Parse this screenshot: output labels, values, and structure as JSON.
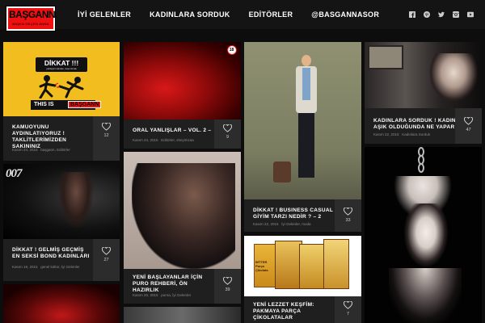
{
  "brand": {
    "name": "BAŞGANN",
    "tagline": "BAŞKA GEÇEN ANNA"
  },
  "nav": [
    "İYİ GELENLER",
    "KADINLARA SORDUK",
    "EDİTÖRLER",
    "@BASGANNASOR"
  ],
  "social": [
    "facebook-icon",
    "pinterest-icon",
    "twitter-icon",
    "instagram-icon",
    "youtube-icon"
  ],
  "colors": {
    "brand_red": "#e11111",
    "bg": "#0d0d0d",
    "caption": "#1f1f1f",
    "likes": "#2c2c2c"
  },
  "cards": {
    "c1": {
      "img": {
        "sign": "DİKKAT !!!",
        "sign_sub": "yaklaştırmalıdan, kaçınılmalı",
        "bottom": "THIS IS",
        "bottom_logo": "BAŞGANN"
      },
      "title": "KAMUOYUNU AYDINLATIYORUZ ! TAKLİTLERİMİZDEN SAKININIZ",
      "date": "Kasım 24, 2015",
      "cats": "başgann, Editörler",
      "likes": "12"
    },
    "c2": {
      "img": {
        "logo": "007"
      },
      "title": "DİKKAT ! GELMİŞ GEÇMİŞ EN SEKSİ BOND KADINLARI",
      "date": "Kasım 19, 2015",
      "cats": "genel kültür, İyi Gelenler",
      "likes": "27"
    },
    "c3": {
      "img": {
        "badge": "18"
      },
      "title": "ORAL YANLIŞLAR – VOL. 2 –",
      "date": "Kasım 24, 2015",
      "cats": "Editörler, sheyimzaa",
      "likes": "9"
    },
    "c4": {
      "title": "YENİ BAŞLAYANLAR İÇİN PURO REHBERİ, ÖN HAZIRLIK",
      "date": "Kasım 20, 2015",
      "cats": "purna, İyi Gelenler",
      "likes": "39"
    },
    "c5": {
      "title": "DİKKAT ! BUSINESS CASUAL GİYİM TARZI NEDİR ? – 2",
      "date": "Kasım 22, 2015",
      "cats": "İyi Gelenler, moda",
      "likes": "33"
    },
    "c6": {
      "img": {
        "box_text": "BİTTER Parça Çikolata"
      },
      "title": "YENİ LEZZET KEŞFİM: PAKMAYA PARÇA ÇİKOLATALAR",
      "likes": "7"
    },
    "c7": {
      "title": "KADINLARA SORDUK ! KADIN AŞIK OLDUĞUNDA NE YAPAR",
      "date": "Kasım 22, 2015",
      "cats": "Kadınlara Sorduk",
      "likes": "47"
    }
  }
}
